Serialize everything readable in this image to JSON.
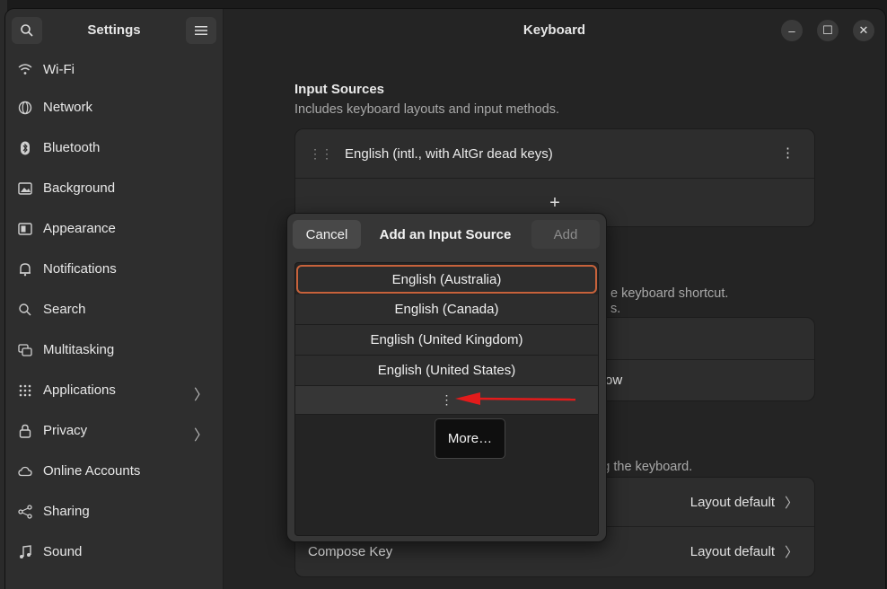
{
  "sidebar": {
    "title": "Settings",
    "items": [
      {
        "label": "Wi-Fi",
        "icon": "wifi-icon"
      },
      {
        "label": "Network",
        "icon": "globe-icon"
      },
      {
        "label": "Bluetooth",
        "icon": "bluetooth-icon"
      },
      {
        "label": "Background",
        "icon": "background-icon"
      },
      {
        "label": "Appearance",
        "icon": "appearance-icon"
      },
      {
        "label": "Notifications",
        "icon": "bell-icon"
      },
      {
        "label": "Search",
        "icon": "search-icon"
      },
      {
        "label": "Multitasking",
        "icon": "multitasking-icon"
      },
      {
        "label": "Applications",
        "icon": "grid-icon",
        "chevron": "〉"
      },
      {
        "label": "Privacy",
        "icon": "lock-icon",
        "chevron": "〉"
      },
      {
        "label": "Online Accounts",
        "icon": "cloud-icon"
      },
      {
        "label": "Sharing",
        "icon": "share-icon"
      },
      {
        "label": "Sound",
        "icon": "music-note-icon"
      }
    ]
  },
  "header": {
    "title": "Keyboard",
    "minimize": "–",
    "maximize": "☐",
    "close": "✕"
  },
  "input_sources": {
    "title": "Input Sources",
    "subtitle": "Includes keyboard layouts and input methods.",
    "source": "English (intl., with AltGr dead keys)",
    "drag_handle": "⋮⋮",
    "kebab": "⋮",
    "add": "+"
  },
  "obscured": {
    "shortcut_text": "e keyboard shortcut.",
    "shortcut_text2": "s.",
    "row_text": "ow",
    "keyboard_text": "ing the keyboard."
  },
  "special_rows": [
    {
      "label": "",
      "value": "Layout default",
      "arrow": "〉"
    },
    {
      "label": "Compose Key",
      "value": "Layout default",
      "arrow": "〉"
    }
  ],
  "dialog": {
    "title": "Add an Input Source",
    "cancel": "Cancel",
    "add": "Add",
    "languages": [
      "English (Australia)",
      "English (Canada)",
      "English (United Kingdom)",
      "English (United States)"
    ],
    "more_dots": "⋮",
    "more_button": "More…",
    "accent": "#c7623b"
  },
  "annotation": {
    "arrow_color": "#e31b1b"
  }
}
